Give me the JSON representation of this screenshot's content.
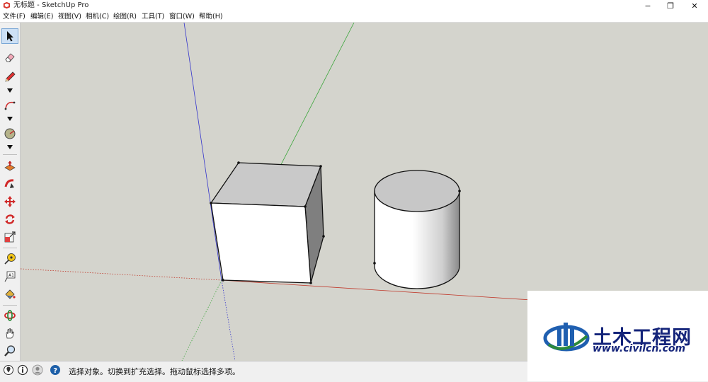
{
  "window": {
    "title": "无标题 - SketchUp Pro",
    "minimize_glyph": "−",
    "restore_glyph": "❐",
    "close_glyph": "✕"
  },
  "menu": {
    "items": [
      {
        "label": "文件(F)"
      },
      {
        "label": "编辑(E)"
      },
      {
        "label": "视图(V)"
      },
      {
        "label": "相机(C)"
      },
      {
        "label": "绘图(R)"
      },
      {
        "label": "工具(T)"
      },
      {
        "label": "窗口(W)"
      },
      {
        "label": "帮助(H)"
      }
    ]
  },
  "toolbar": {
    "tools": [
      {
        "name": "select-tool",
        "icon": "arrow-cursor-icon",
        "active": true
      },
      {
        "name": "eraser-tool",
        "icon": "eraser-icon"
      },
      {
        "name": "pencil-tool",
        "icon": "pencil-icon"
      },
      {
        "name": "arc-tool",
        "icon": "arc-icon"
      },
      {
        "name": "shape-tool",
        "icon": "circle-shape-icon"
      },
      {
        "name": "push-pull-tool",
        "icon": "push-pull-icon"
      },
      {
        "name": "follow-me-tool",
        "icon": "follow-me-icon"
      },
      {
        "name": "move-tool",
        "icon": "move-arrows-icon"
      },
      {
        "name": "rotate-tool",
        "icon": "rotate-icon"
      },
      {
        "name": "scale-tool",
        "icon": "scale-icon"
      },
      {
        "name": "tape-measure-tool",
        "icon": "tape-measure-icon"
      },
      {
        "name": "text-tool",
        "icon": "text-label-icon"
      },
      {
        "name": "paint-bucket-tool",
        "icon": "paint-bucket-icon"
      },
      {
        "name": "orbit-tool",
        "icon": "orbit-icon"
      },
      {
        "name": "pan-tool",
        "icon": "hand-icon"
      },
      {
        "name": "zoom-tool",
        "icon": "magnifier-icon"
      }
    ]
  },
  "status": {
    "text": "选择对象。切换到扩充选择。拖动鼠标选择多项。",
    "icons": [
      "geo-location-icon",
      "credits-icon",
      "user-icon",
      "help-icon"
    ]
  },
  "watermark": {
    "name": "土木工程网",
    "url": "www.civilcn.com"
  },
  "colors": {
    "viewport_bg": "#d4d4cd",
    "axis_red": "#c0392b",
    "axis_green": "#3aa53a",
    "axis_blue": "#3333cc",
    "watermark_blue": "#14247a"
  }
}
